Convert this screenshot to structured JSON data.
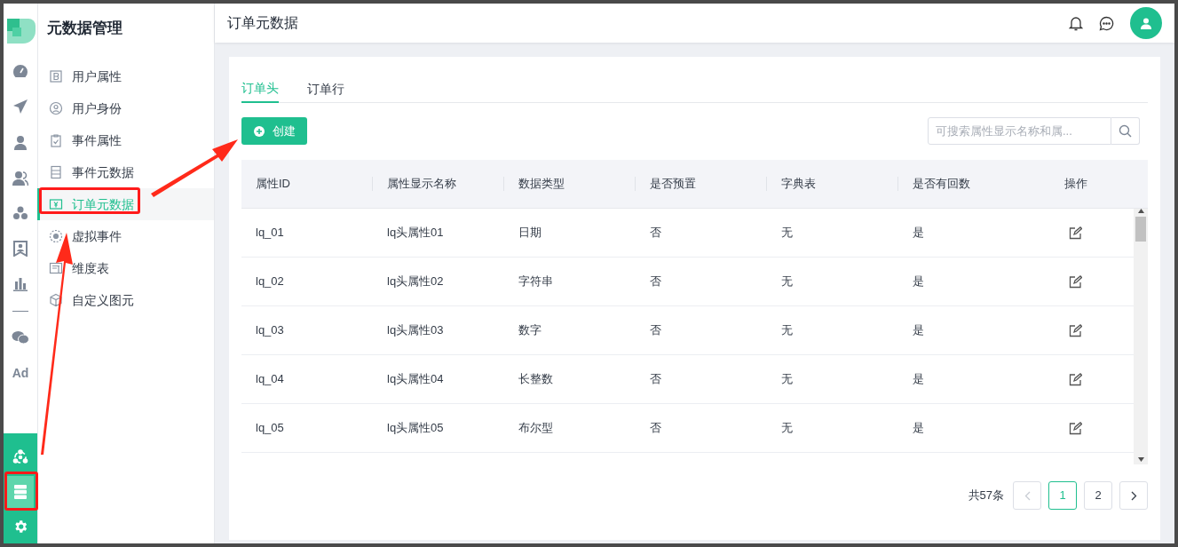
{
  "sidebar": {
    "title": "元数据管理",
    "items": [
      {
        "label": "用户属性",
        "kind": "b-square",
        "selected": false
      },
      {
        "label": "用户身份",
        "kind": "user-circle",
        "selected": false
      },
      {
        "label": "事件属性",
        "kind": "clipboard",
        "selected": false
      },
      {
        "label": "事件元数据",
        "kind": "server",
        "selected": false
      },
      {
        "label": "订单元数据",
        "kind": "yen",
        "selected": true
      },
      {
        "label": "虚拟事件",
        "kind": "dotted-circle",
        "selected": false
      },
      {
        "label": "维度表",
        "kind": "table",
        "selected": false
      },
      {
        "label": "自定义图元",
        "kind": "cube",
        "selected": false
      }
    ]
  },
  "rail": {
    "items": [
      {
        "kind": "gauge"
      },
      {
        "kind": "send"
      },
      {
        "kind": "user"
      },
      {
        "kind": "users"
      },
      {
        "kind": "cluster"
      },
      {
        "kind": "badge"
      },
      {
        "kind": "bar-chart"
      },
      {
        "kind": "divider"
      },
      {
        "kind": "wechat"
      },
      {
        "kind": "ad",
        "label": "Ad"
      }
    ],
    "bottom": [
      {
        "kind": "share",
        "selected": false
      },
      {
        "kind": "server",
        "selected": true
      },
      {
        "kind": "gear",
        "selected": false
      }
    ]
  },
  "header": {
    "title": "订单元数据"
  },
  "tabs": [
    {
      "label": "订单头",
      "selected": true
    },
    {
      "label": "订单行",
      "selected": false
    }
  ],
  "create_button": "创建",
  "search": {
    "placeholder": "可搜索属性显示名称和属..."
  },
  "table": {
    "columns": [
      "属性ID",
      "属性显示名称",
      "数据类型",
      "是否预置",
      "字典表",
      "是否有回数",
      "操作"
    ],
    "rows": [
      [
        "lq_01",
        "lq头属性01",
        "日期",
        "否",
        "无",
        "是"
      ],
      [
        "lq_02",
        "lq头属性02",
        "字符串",
        "否",
        "无",
        "是"
      ],
      [
        "lq_03",
        "lq头属性03",
        "数字",
        "否",
        "无",
        "是"
      ],
      [
        "lq_04",
        "lq头属性04",
        "长整数",
        "否",
        "无",
        "是"
      ],
      [
        "lq_05",
        "lq头属性05",
        "布尔型",
        "否",
        "无",
        "是"
      ]
    ]
  },
  "pagination": {
    "total": "共57条",
    "pages": [
      {
        "label": "1",
        "selected": true
      },
      {
        "label": "2",
        "selected": false
      }
    ],
    "prev_disabled": true
  }
}
